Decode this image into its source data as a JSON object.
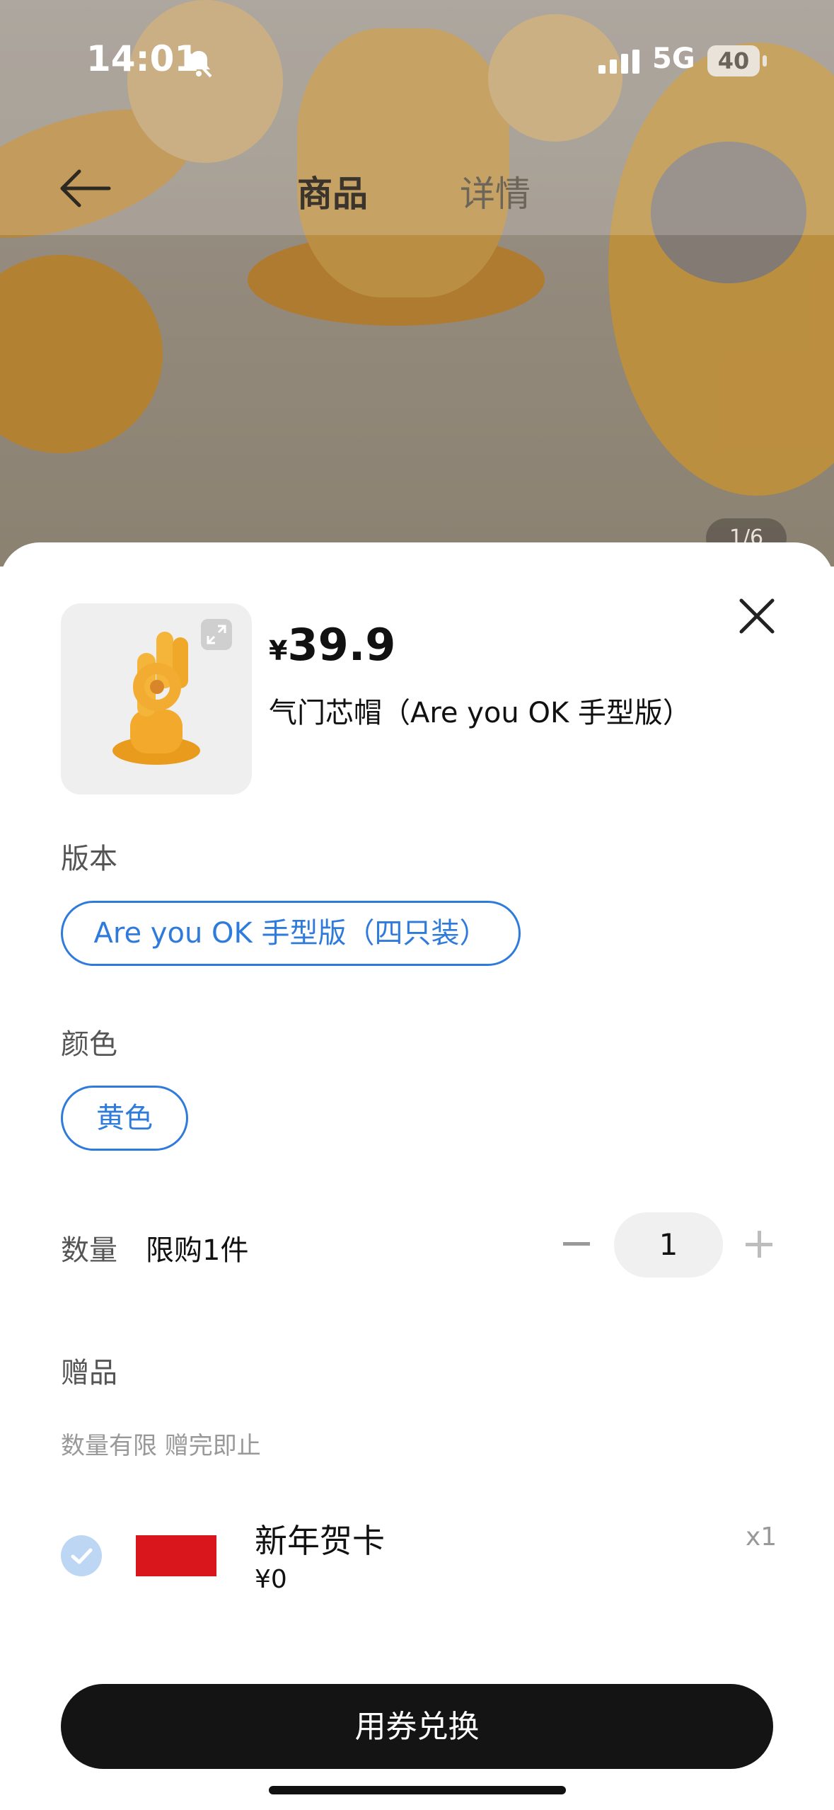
{
  "status_bar": {
    "time": "14:01",
    "network": "5G",
    "battery": "40"
  },
  "nav": {
    "tab_goods": "商品",
    "tab_detail": "详情"
  },
  "gallery": {
    "page_indicator": "1/6"
  },
  "product": {
    "currency": "¥",
    "price": "39.9",
    "name": "气门芯帽（Are you OK 手型版）"
  },
  "options": {
    "version_label": "版本",
    "version_value": "Are you OK 手型版（四只装）",
    "color_label": "颜色",
    "color_value": "黄色"
  },
  "quantity": {
    "label": "数量",
    "limit": "限购1件",
    "value": "1"
  },
  "gift": {
    "label": "赠品",
    "note": "数量有限 赠完即止",
    "name": "新年贺卡",
    "price": "¥0",
    "count": "x1"
  },
  "cta": {
    "label": "用券兑换"
  },
  "colors": {
    "accent": "#2f7bdc",
    "button": "#141414",
    "card": "#d8161c",
    "hand": "#f1a72a"
  },
  "icons": [
    "bell-slash-icon",
    "signal-icon",
    "back-arrow-icon",
    "expand-icon",
    "close-icon",
    "minus-icon",
    "plus-icon",
    "check-icon"
  ]
}
